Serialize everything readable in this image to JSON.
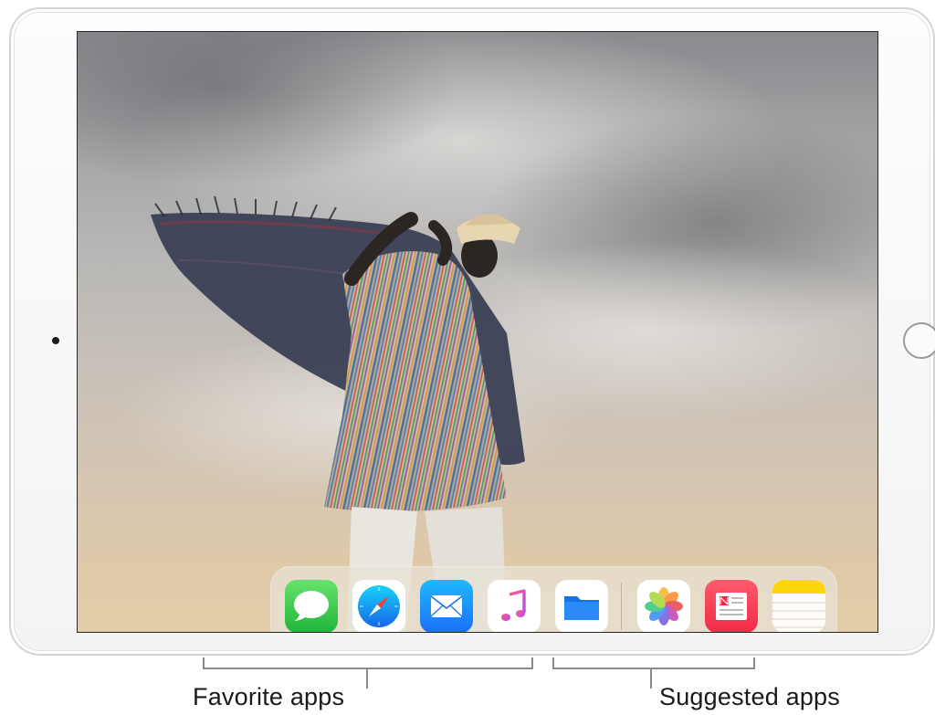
{
  "dock": {
    "favorite_apps": [
      {
        "name": "Messages",
        "icon": "messages-icon",
        "color": "#34c759"
      },
      {
        "name": "Safari",
        "icon": "safari-icon",
        "color": "#1e88e5"
      },
      {
        "name": "Mail",
        "icon": "mail-icon",
        "color": "#1a8cff"
      },
      {
        "name": "Music",
        "icon": "music-icon",
        "color": "#fc3c44"
      },
      {
        "name": "Files",
        "icon": "files-icon",
        "color": "#1e7ef5"
      }
    ],
    "suggested_apps": [
      {
        "name": "Photos",
        "icon": "photos-icon",
        "color": "#ffffff"
      },
      {
        "name": "News",
        "icon": "news-icon",
        "color": "#fa3b52"
      },
      {
        "name": "Notes",
        "icon": "notes-icon",
        "color": "#ffd60a"
      }
    ]
  },
  "callouts": {
    "favorite_label": "Favorite apps",
    "suggested_label": "Suggested apps"
  },
  "colors": {
    "frame": "#f5f5f5",
    "dock_background": "#e8e2d6",
    "sky_top": "#8a8a8e",
    "sky_bottom": "#e3cda8"
  }
}
